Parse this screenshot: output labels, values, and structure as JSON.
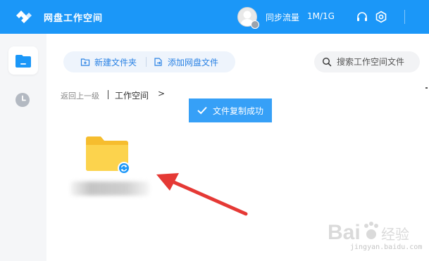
{
  "header": {
    "app_title": "网盘工作空间",
    "sync_label": "同步流量",
    "sync_value": "1M/1G"
  },
  "toolbar": {
    "new_folder_label": "新建文件夹",
    "add_file_label": "添加网盘文件"
  },
  "search": {
    "placeholder": "搜索工作空间文件"
  },
  "breadcrumb": {
    "back_label": "返回上一级",
    "current_label": "工作空间",
    "separator": ">"
  },
  "toast": {
    "message": "文件复制成功"
  },
  "watermark": {
    "brand": "Bai",
    "brand_cn": "经验",
    "url": "jingyan.baidu.com"
  },
  "colors": {
    "titlebar": "#1b97f8",
    "accent": "#2a82e4",
    "toast": "#36a0f7",
    "folder": "#fcd34d",
    "arrow": "#e53935"
  },
  "icons": {
    "logo": "logo-icon",
    "avatar": "avatar",
    "headset": "headset-icon",
    "settings": "gear-icon",
    "new_folder": "new-folder-icon",
    "add_file": "add-file-icon",
    "search": "search-icon",
    "files_nav": "folder-nav-icon",
    "recent_nav": "clock-icon",
    "check": "check-icon",
    "sync": "sync-badge-icon"
  }
}
